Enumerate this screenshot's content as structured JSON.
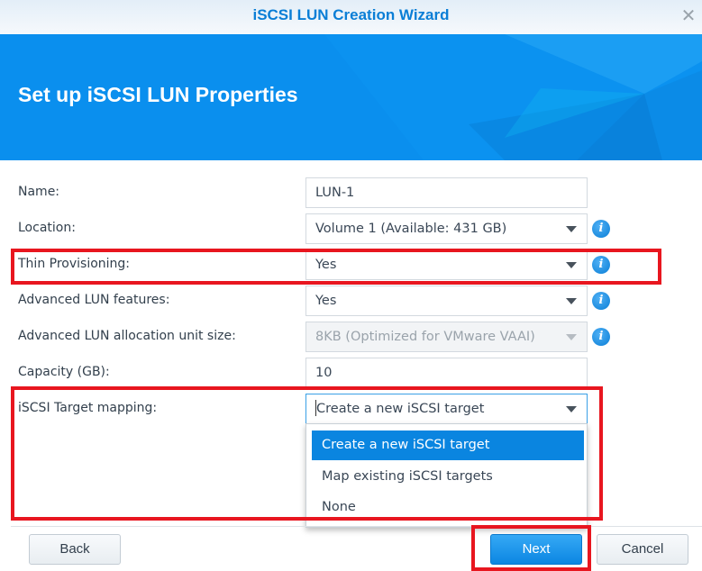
{
  "window": {
    "title": "iSCSI LUN Creation Wizard",
    "close_icon": "close-icon"
  },
  "banner": {
    "heading": "Set up iSCSI LUN Properties"
  },
  "form": {
    "name": {
      "label": "Name:",
      "value": "LUN-1"
    },
    "location": {
      "label": "Location:",
      "value": "Volume 1 (Available: 431 GB)"
    },
    "thin_provisioning": {
      "label": "Thin Provisioning:",
      "value": "Yes"
    },
    "advanced_features": {
      "label": "Advanced LUN features:",
      "value": "Yes"
    },
    "allocation_unit": {
      "label": "Advanced LUN allocation unit size:",
      "value": "8KB (Optimized for VMware VAAI)",
      "disabled": true
    },
    "capacity": {
      "label": "Capacity (GB):",
      "value": "10"
    },
    "target_mapping": {
      "label": "iSCSI Target mapping:",
      "value": "Create a new iSCSI target",
      "options": [
        "Create a new iSCSI target",
        "Map existing iSCSI targets",
        "None"
      ],
      "selected_index": 0
    },
    "info_icon_glyph": "i"
  },
  "footer": {
    "back_label": "Back",
    "next_label": "Next",
    "cancel_label": "Cancel"
  },
  "colors": {
    "accent": "#0a85e0",
    "highlight": "#e8161f",
    "title": "#0a7ed6"
  },
  "close_glyph": "✕"
}
